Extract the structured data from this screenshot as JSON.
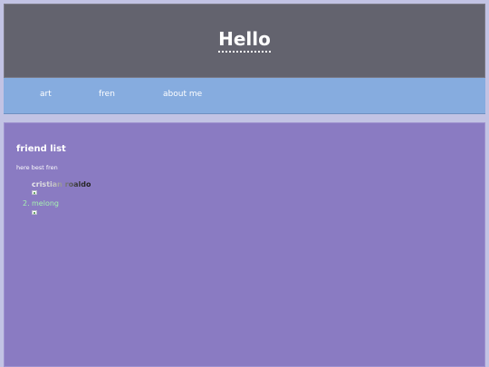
{
  "header": {
    "title": "Hello"
  },
  "nav": {
    "items": [
      {
        "label": "art"
      },
      {
        "label": "fren"
      },
      {
        "label": "about me"
      }
    ]
  },
  "main": {
    "heading": "friend list",
    "description": "here best fren",
    "friends": [
      {
        "name": "cristian roaldo",
        "image": "broken-image-icon"
      },
      {
        "number": "2.",
        "name": "melong",
        "image": "broken-image-icon"
      }
    ]
  }
}
